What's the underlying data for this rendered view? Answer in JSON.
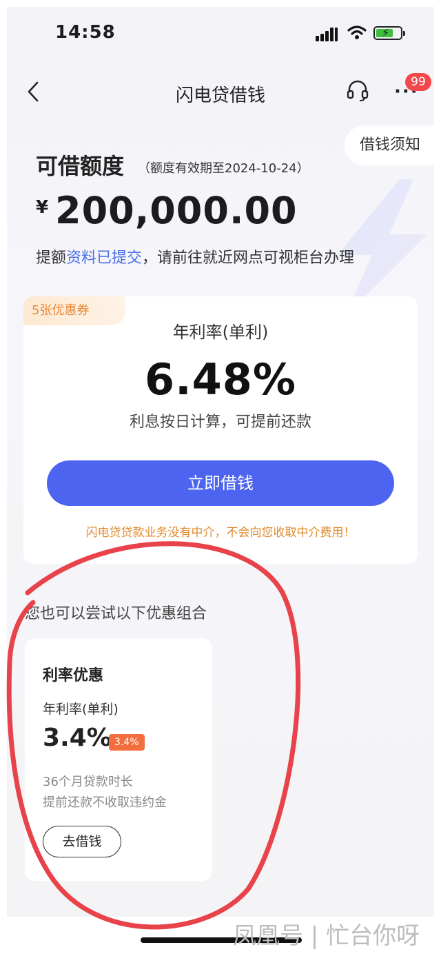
{
  "status_bar": {
    "time": "14:58"
  },
  "nav": {
    "title": "闪电贷借钱",
    "badge_count": "99",
    "notice_label": "借钱须知"
  },
  "limit": {
    "title": "可借额度",
    "valid_until": "（额度有效期至2024-10-24）",
    "currency": "¥",
    "amount": "200,000.00",
    "tip_prefix": "提额",
    "tip_link": "资料已提交",
    "tip_suffix": "，请前往就近网点可视柜台办理"
  },
  "main_card": {
    "coupon": "5张优惠券",
    "rate_label": "年利率(单利)",
    "rate_value": "6.48%",
    "rate_note": "利息按日计算，可提前还款",
    "borrow_button": "立即借钱",
    "warning": "闪电贷贷款业务没有中介，不会向您收取中介费用！"
  },
  "alt_section": {
    "title": "您也可以尝试以下优惠组合",
    "card": {
      "title": "利率优惠",
      "rate_label": "年利率(单利)",
      "rate_value": "3.4%",
      "rate_tag": "3.4%",
      "desc1": "36个月贷款时长",
      "desc2": "提前还款不收取违约金",
      "button": "去借钱"
    }
  },
  "watermark": "凤凰号 | 忙台你呀",
  "colors": {
    "primary": "#4c64ef",
    "warning": "#e08a2c",
    "annotation": "#e8424a",
    "badge": "#f2474b"
  },
  "icons": [
    "back-chevron-icon",
    "headset-icon",
    "more-dots-icon",
    "signal-icon",
    "wifi-icon",
    "battery-icon"
  ]
}
